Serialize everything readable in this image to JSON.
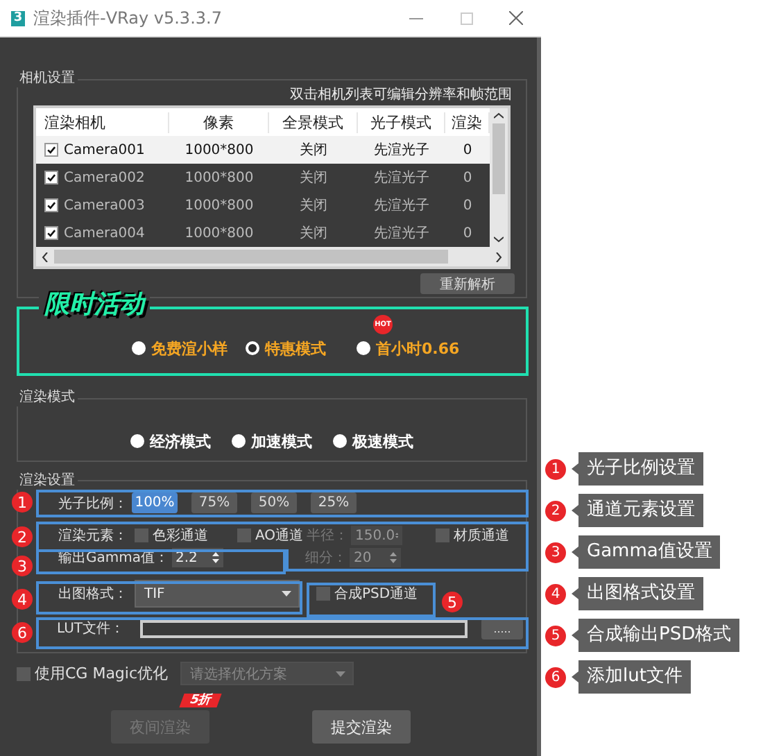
{
  "window": {
    "app_icon_label": "3",
    "title": "渲染插件-VRay v5.3.3.7"
  },
  "camera_settings": {
    "title": "相机设置",
    "hint": "双击相机列表可编辑分辨率和帧范围",
    "table": {
      "columns": [
        "渲染相机",
        "像素",
        "全景模式",
        "光子模式",
        "渲染"
      ],
      "rows": [
        {
          "checked": true,
          "selected": true,
          "cells": [
            "Camera001",
            "1000*800",
            "关闭",
            "先渲光子",
            "0"
          ]
        },
        {
          "checked": true,
          "selected": false,
          "cells": [
            "Camera002",
            "1000*800",
            "关闭",
            "先渲光子",
            "0"
          ]
        },
        {
          "checked": true,
          "selected": false,
          "cells": [
            "Camera003",
            "1000*800",
            "关闭",
            "先渲光子",
            "0"
          ]
        },
        {
          "checked": true,
          "selected": false,
          "cells": [
            "Camera004",
            "1000*800",
            "关闭",
            "先渲光子",
            "0"
          ]
        }
      ]
    },
    "reparse_button": "重新解析"
  },
  "promo": {
    "title": "限时活动",
    "options": [
      {
        "label": "免费渲小样",
        "selected": false
      },
      {
        "label": "特惠模式",
        "selected": true
      },
      {
        "label": "首小时0.66",
        "selected": false,
        "badge": "HOT"
      }
    ]
  },
  "render_mode": {
    "title": "渲染模式",
    "options": [
      {
        "label": "经济模式",
        "selected": false
      },
      {
        "label": "加速模式",
        "selected": false
      },
      {
        "label": "极速模式",
        "selected": false
      }
    ]
  },
  "render_settings": {
    "title": "渲染设置",
    "photon_ratio": {
      "label": "光子比例：",
      "options": [
        {
          "label": "100%",
          "selected": true
        },
        {
          "label": "75%",
          "selected": false
        },
        {
          "label": "50%",
          "selected": false
        },
        {
          "label": "25%",
          "selected": false
        }
      ]
    },
    "elements": {
      "label": "渲染元素：",
      "channels": [
        {
          "label": "色彩通道",
          "checked": false
        },
        {
          "label": "AO通道",
          "checked": false
        }
      ],
      "radius": {
        "label": "半径：",
        "value": "150.0",
        "disabled": true
      },
      "subdivisions": {
        "label": "细分：",
        "value": "20",
        "disabled": true
      },
      "material": {
        "label": "材质通道",
        "checked": false
      }
    },
    "gamma": {
      "label": "输出Gamma值：",
      "value": "2.2"
    },
    "output_format": {
      "label": "出图格式：",
      "value": "TIF"
    },
    "psd": {
      "label": "合成PSD通道",
      "checked": false
    },
    "lut": {
      "label": "LUT文件：",
      "button": "....."
    }
  },
  "cg_magic": {
    "label": "使用CG Magic优化",
    "checked": false,
    "placeholder": "请选择优化方案",
    "disabled": true
  },
  "actions": [
    {
      "label": "夜间渲染",
      "disabled": true,
      "badge": "5折"
    },
    {
      "label": "提交渲染",
      "disabled": false
    }
  ],
  "annotations": [
    {
      "marker": "1",
      "number": "1",
      "label": "光子比例设置"
    },
    {
      "marker": "2",
      "number": "2",
      "label": "通道元素设置"
    },
    {
      "marker": "3",
      "number": "3",
      "label": "Gamma值设置"
    },
    {
      "marker": "4",
      "number": "4",
      "label": "出图格式设置"
    },
    {
      "marker": "5",
      "number": "5",
      "label": "合成输出PSD格式"
    },
    {
      "marker": "6",
      "number": "6",
      "label": "添加lut文件"
    }
  ]
}
